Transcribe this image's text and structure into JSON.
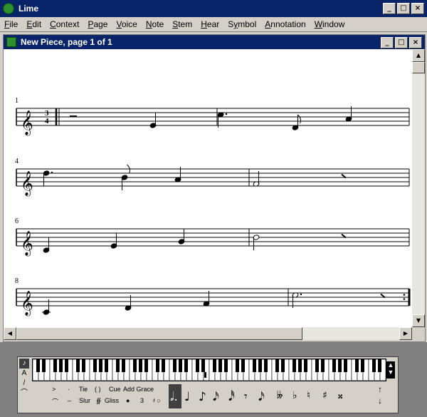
{
  "app": {
    "title": "Lime",
    "buttons": {
      "minimize": "_",
      "maximize": "□",
      "close": "×"
    }
  },
  "menu": [
    {
      "label": "File",
      "mnemonic_index": 0
    },
    {
      "label": "Edit",
      "mnemonic_index": 0
    },
    {
      "label": "Context",
      "mnemonic_index": 0
    },
    {
      "label": "Page",
      "mnemonic_index": 0
    },
    {
      "label": "Voice",
      "mnemonic_index": 0
    },
    {
      "label": "Note",
      "mnemonic_index": 0
    },
    {
      "label": "Stem",
      "mnemonic_index": 0
    },
    {
      "label": "Hear",
      "mnemonic_index": 0
    },
    {
      "label": "Symbol",
      "mnemonic_index": 1
    },
    {
      "label": "Annotation",
      "mnemonic_index": 0
    },
    {
      "label": "Window",
      "mnemonic_index": 0
    }
  ],
  "document": {
    "title": "New Piece, page 1 of 1",
    "systems": [
      {
        "measure_number": "1"
      },
      {
        "measure_number": "4"
      },
      {
        "measure_number": "6"
      },
      {
        "measure_number": "8"
      }
    ],
    "time_signature": {
      "top": "3",
      "bottom": "4"
    }
  },
  "palette": {
    "tools_row1": [
      "Tie",
      "( )",
      "Cue",
      "Add Grace"
    ],
    "tools_row2": [
      "Slur",
      "Gliss",
      "3"
    ],
    "accent_symbols": [
      ">",
      "·",
      "⌒",
      "–"
    ],
    "note_values": [
      "𝅗𝅥.",
      "♩",
      "♪",
      "𝅘𝅥𝅯",
      "𝅘𝅥𝅰",
      "𝄾",
      "𝅘𝅥𝅯"
    ],
    "accidentals": [
      "𝄫",
      "♭",
      "♮",
      "♯",
      "𝄪"
    ]
  },
  "colors": {
    "titlebar": "#0a246a",
    "window_bg": "#d4d0c8",
    "icon_green": "#2f8f2f"
  }
}
